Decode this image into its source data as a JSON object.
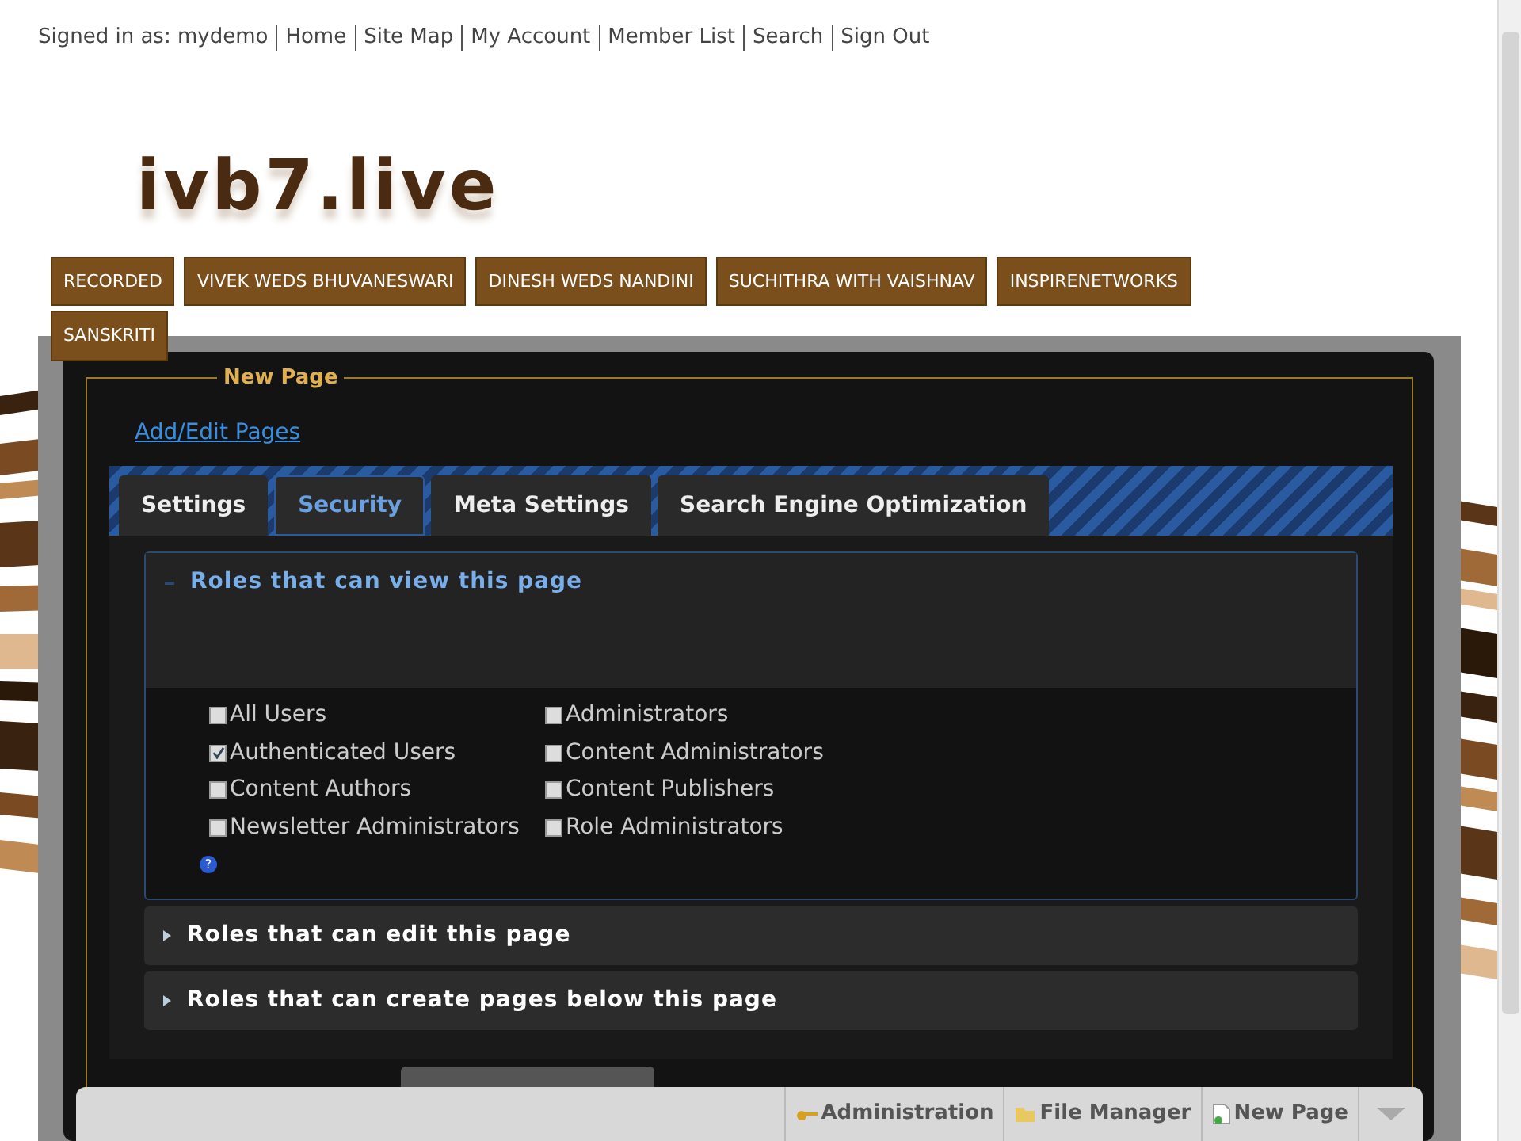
{
  "user_bar": {
    "signed_in": "Signed in as: mydemo",
    "links": [
      "Home",
      "Site Map",
      "My Account",
      "Member List",
      "Search",
      "Sign Out"
    ]
  },
  "logo": "ivb7.live",
  "nav_tabs": [
    "RECORDED",
    "VIVEK WEDS BHUVANESWARI",
    "DINESH WEDS NANDINI",
    "SUCHITHRA WITH VAISHNAV",
    "INSPIRENETWORKS",
    "SANSKRITI"
  ],
  "panel": {
    "title": "New Page",
    "link": "Add/Edit Pages",
    "tabs": [
      {
        "label": "Settings",
        "selected": false
      },
      {
        "label": "Security",
        "selected": true
      },
      {
        "label": "Meta Settings",
        "selected": false
      },
      {
        "label": "Search Engine Optimization",
        "selected": false
      }
    ],
    "sections": [
      {
        "title": "Roles that can view this page",
        "expanded": true,
        "help": "?",
        "roles": [
          {
            "label": "All Users",
            "checked": false
          },
          {
            "label": "Authenticated Users",
            "checked": true
          },
          {
            "label": "Content Authors",
            "checked": false
          },
          {
            "label": "Newsletter Administrators",
            "checked": false
          },
          {
            "label": "Administrators",
            "checked": false
          },
          {
            "label": "Content Administrators",
            "checked": false
          },
          {
            "label": "Content Publishers",
            "checked": false
          },
          {
            "label": "Role Administrators",
            "checked": false
          }
        ]
      },
      {
        "title": "Roles that can edit this page",
        "expanded": false
      },
      {
        "title": "Roles that can create pages below this page",
        "expanded": false
      }
    ]
  },
  "control_bar": [
    "Administration",
    "File Manager",
    "New Page"
  ]
}
